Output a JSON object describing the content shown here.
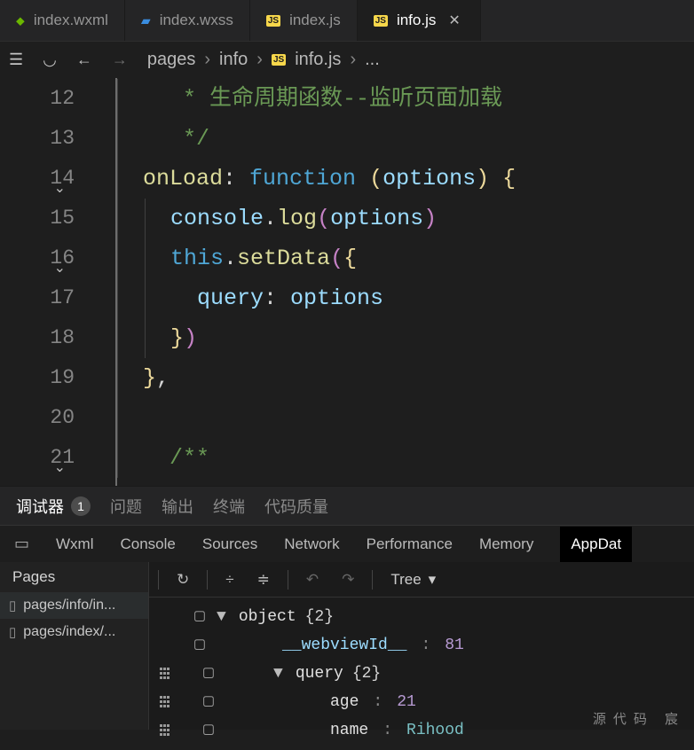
{
  "tabs": [
    {
      "icon": "wxml",
      "label": "index.wxml"
    },
    {
      "icon": "wxss",
      "label": "index.wxss"
    },
    {
      "icon": "js",
      "label": "index.js"
    },
    {
      "icon": "js",
      "label": "info.js",
      "active": true
    }
  ],
  "breadcrumb": {
    "p0": "pages",
    "p1": "info",
    "p2": "info.js",
    "ellipsis": "..."
  },
  "lines": {
    "n12": "12",
    "n13": "13",
    "n14": "14",
    "n15": "15",
    "n16": "16",
    "n17": "17",
    "n18": "18",
    "n19": "19",
    "n20": "20",
    "n21": "21"
  },
  "code": {
    "l12_star": "   * ",
    "l12_txt": "生命周期函数--监听页面加载",
    "l13": "   */",
    "l14_name": "onLoad",
    "l14_fn": "function",
    "l14_arg": "options",
    "l15_obj": "console",
    "l15_m": "log",
    "l15_arg": "options",
    "l16_this": "this",
    "l16_m": "setData",
    "l17_k": "query",
    "l17_v": "options",
    "l21": "  /**"
  },
  "dbg_tabs": {
    "debugger": "调试器",
    "badge": "1",
    "issues": "问题",
    "output": "输出",
    "terminal": "终端",
    "quality": "代码质量"
  },
  "dev_tabs": {
    "wxml": "Wxml",
    "console": "Console",
    "sources": "Sources",
    "network": "Network",
    "performance": "Performance",
    "memory": "Memory",
    "appdata": "AppDat"
  },
  "pages_panel": {
    "title": "Pages",
    "items": [
      "pages/info/in...",
      "pages/index/..."
    ]
  },
  "toolbar": {
    "view": "Tree"
  },
  "tree": {
    "root_label": "object",
    "root_count": "{2}",
    "webview_key": "__webviewId__",
    "webview_val": "81",
    "query_key": "query",
    "query_count": "{2}",
    "age_key": "age",
    "age_val": "21",
    "name_key": "name",
    "name_val": "Rihood"
  },
  "footer": "源代码  宸"
}
